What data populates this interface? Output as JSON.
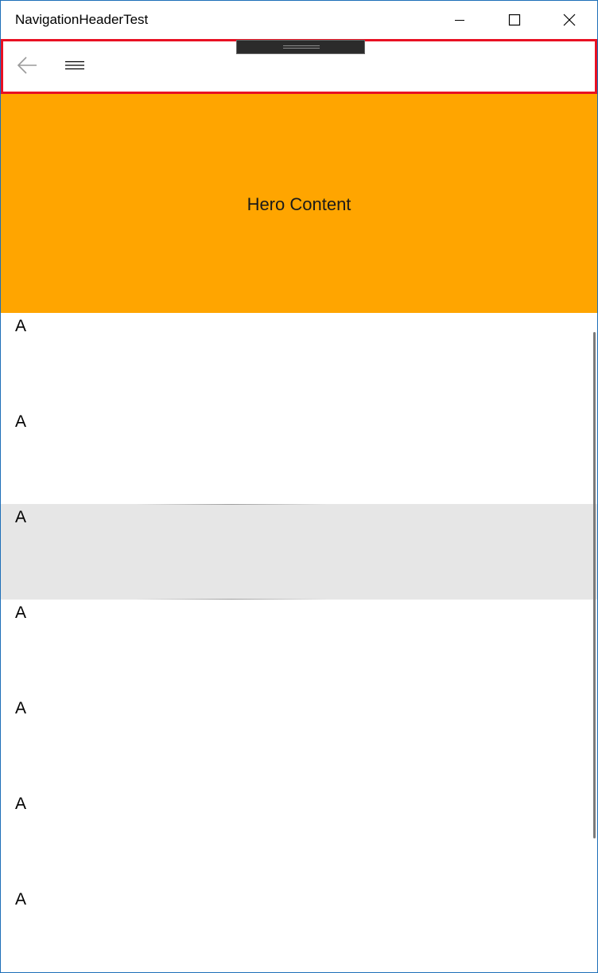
{
  "window": {
    "title": "NavigationHeaderTest",
    "caption_buttons": [
      {
        "name": "minimize",
        "icon": "minimize-icon"
      },
      {
        "name": "maximize",
        "icon": "maximize-icon"
      },
      {
        "name": "close",
        "icon": "close-icon"
      }
    ]
  },
  "nav_header": {
    "back_icon": "back-arrow-icon",
    "menu_icon": "hamburger-icon",
    "border_color": "#e81123"
  },
  "hero": {
    "text": "Hero Content",
    "background": "#ffa500"
  },
  "list": {
    "items": [
      {
        "label": "A",
        "selected": false
      },
      {
        "label": "A",
        "selected": false
      },
      {
        "label": "A",
        "selected": true
      },
      {
        "label": "A",
        "selected": false
      },
      {
        "label": "A",
        "selected": false
      },
      {
        "label": "A",
        "selected": false
      },
      {
        "label": "A",
        "selected": false
      }
    ],
    "selected_background": "#e6e6e6"
  }
}
